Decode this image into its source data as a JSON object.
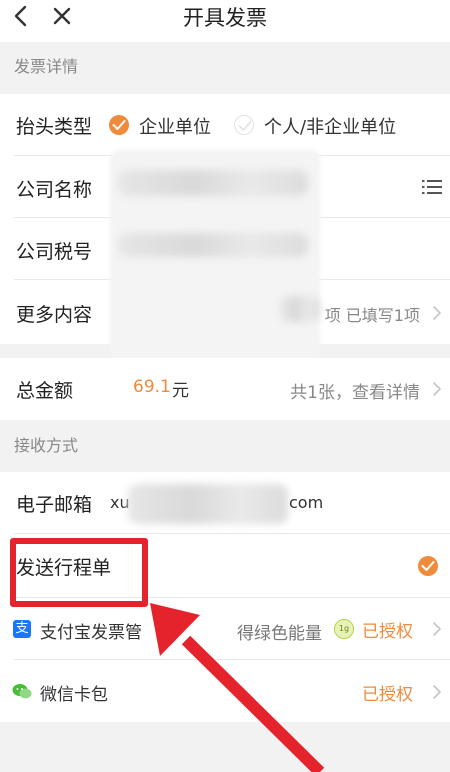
{
  "header": {
    "title": "开具发票"
  },
  "sections": {
    "invoice_details": "发票详情",
    "delivery": "接收方式"
  },
  "invoice_type": {
    "label": "抬头类型",
    "option_company": "企业单位",
    "option_personal": "个人/非企业单位",
    "selected": "企业单位"
  },
  "company_name": {
    "label": "公司名称"
  },
  "tax_id": {
    "label": "公司税号"
  },
  "more_content": {
    "label": "更多内容",
    "value": "项 已填写1项"
  },
  "total": {
    "label": "总金额",
    "amount": "69.1",
    "unit": "元",
    "detail": "共1张，查看详情"
  },
  "email": {
    "label": "电子邮箱",
    "prefix": "xu",
    "suffix": "com"
  },
  "itinerary": {
    "label": "发送行程单",
    "checked": true
  },
  "alipay": {
    "label": "支付宝发票管",
    "energy_text": "得绿色能量",
    "status": "已授权"
  },
  "wechat": {
    "label": "微信卡包",
    "status": "已授权"
  },
  "colors": {
    "accent": "#f08a3c",
    "highlight": "#e5232d",
    "alipay_blue": "#1677ff",
    "wechat_green": "#46bb36"
  }
}
